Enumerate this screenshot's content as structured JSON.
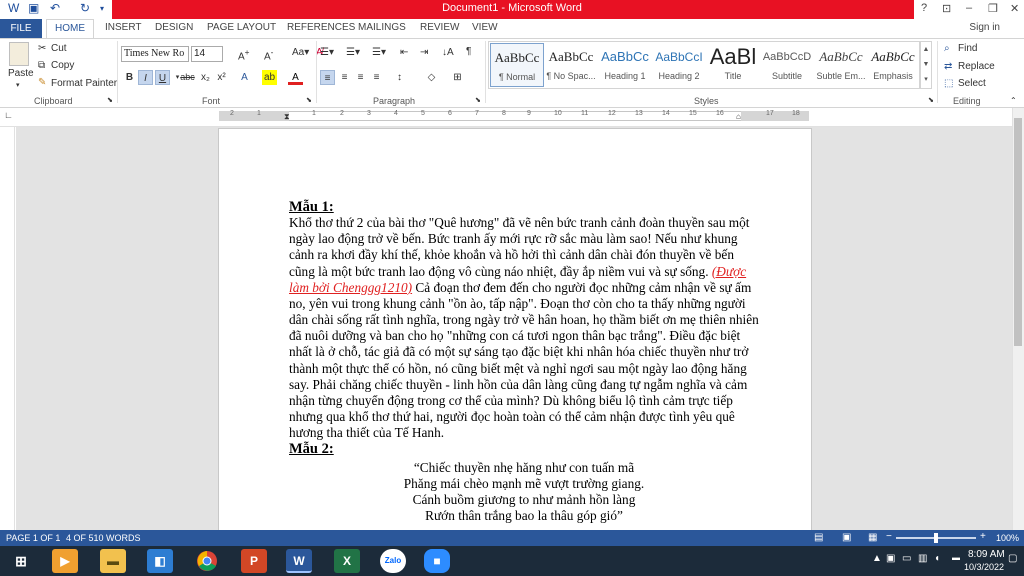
{
  "window": {
    "title": "Document1 - Microsoft Word"
  },
  "quick_access": {
    "save_icon": "save-icon",
    "undo_icon": "undo-icon",
    "redo_icon": "redo-icon"
  },
  "window_controls": {
    "help": "?",
    "minimize": "–",
    "restore": "❐",
    "close": "✕"
  },
  "tabs": [
    "FILE",
    "HOME",
    "INSERT",
    "DESIGN",
    "PAGE LAYOUT",
    "REFERENCES",
    "MAILINGS",
    "REVIEW",
    "VIEW"
  ],
  "signin": "Sign in",
  "clipboard": {
    "label": "Clipboard",
    "paste": "Paste",
    "cut": "Cut",
    "copy": "Copy",
    "format_painter": "Format Painter"
  },
  "font": {
    "label": "Font",
    "family": "Times New Ro",
    "size": "14"
  },
  "paragraph": {
    "label": "Paragraph"
  },
  "styles": {
    "label": "Styles",
    "items": [
      {
        "preview": "AaBbCc",
        "name": "¶ Normal"
      },
      {
        "preview": "AaBbCc",
        "name": "¶ No Spac..."
      },
      {
        "preview": "AaBbCc",
        "name": "Heading 1"
      },
      {
        "preview": "AaBbCcI",
        "name": "Heading 2"
      },
      {
        "preview": "AaBl",
        "name": "Title"
      },
      {
        "preview": "AaBbCcD",
        "name": "Subtitle"
      },
      {
        "preview": "AaBbCc",
        "name": "Subtle Em..."
      },
      {
        "preview": "AaBbCc",
        "name": "Emphasis"
      }
    ]
  },
  "editing": {
    "label": "Editing",
    "find": "Find",
    "replace": "Replace",
    "select": "Select"
  },
  "ruler": {
    "numbers": [
      "2",
      "1",
      "1",
      "2",
      "3",
      "4",
      "5",
      "6",
      "7",
      "8",
      "9",
      "10",
      "11",
      "12",
      "13",
      "14",
      "15",
      "16",
      "17",
      "18"
    ]
  },
  "document": {
    "heading1": "Mẫu 1:",
    "para1_before": "Khổ thơ thứ 2 của bài thơ \"Quê hương\" đã vẽ nên bức tranh cảnh đoàn thuyền sau một ngày lao động trở về bến. Bức tranh ấy mới rực rỡ sắc màu làm sao! Nếu như khung cảnh ra khơi đầy khí thế, khỏe khoắn và hồ hởi thì cảnh dân chài đón thuyền về bến cũng là một bức tranh lao động vô cùng náo nhiệt, đầy ắp niềm vui và sự sống. ",
    "para1_red": "(Được làm bởi Chenggg1210)",
    "para1_after": " Cả đoạn thơ đem đến cho người đọc những cảm nhận về sự ấm no, yên vui trong khung cảnh \"ồn ào, tấp nập\". Đoạn thơ còn cho ta thấy những người dân chài sống rất tình nghĩa, trong ngày trở về hân hoan, họ thầm biết ơn mẹ thiên nhiên đã nuôi dưỡng và ban cho họ \"những con cá tươi ngon thân bạc trắng\". Điều đặc biệt nhất là ở chỗ, tác giả đã có một sự sáng tạo đặc biệt khi nhân hóa chiếc thuyền như trở thành một thực thể có hồn, nó cũng biết mệt và nghỉ ngơi sau một ngày lao động hăng say. Phải chăng chiếc thuyền - linh hồn của dân làng cũng đang tự ngẫm nghĩa và cảm nhận từng chuyển động trong cơ thể của mình? Dù không biểu lộ tình cảm trực tiếp nhưng qua khổ thơ thứ hai, người đọc hoàn toàn có thể cảm nhận được tình yêu quê hương tha thiết của Tế Hanh.",
    "heading2": "Mẫu 2:",
    "poem": [
      "“Chiếc thuyền nhẹ hăng như con tuấn mã",
      "Phăng mái chèo mạnh mẽ vượt trường giang.",
      "Cánh buồm giương to như mảnh hồn làng",
      "Rướn thân trắng bao la thâu góp gió”"
    ]
  },
  "status": {
    "page": "PAGE 1 OF 1",
    "words": "4 OF 510 WORDS",
    "zoom": "100%"
  },
  "taskbar": {
    "time": "8:09 AM",
    "date": "10/3/2022",
    "apps": [
      "media",
      "explorer",
      "store",
      "chrome",
      "powerpoint",
      "word",
      "excel",
      "zalo",
      "zoom"
    ]
  },
  "colors": {
    "accent": "#2b579a",
    "titlebar": "#e81123",
    "taskbar": "#1c2b3a"
  }
}
